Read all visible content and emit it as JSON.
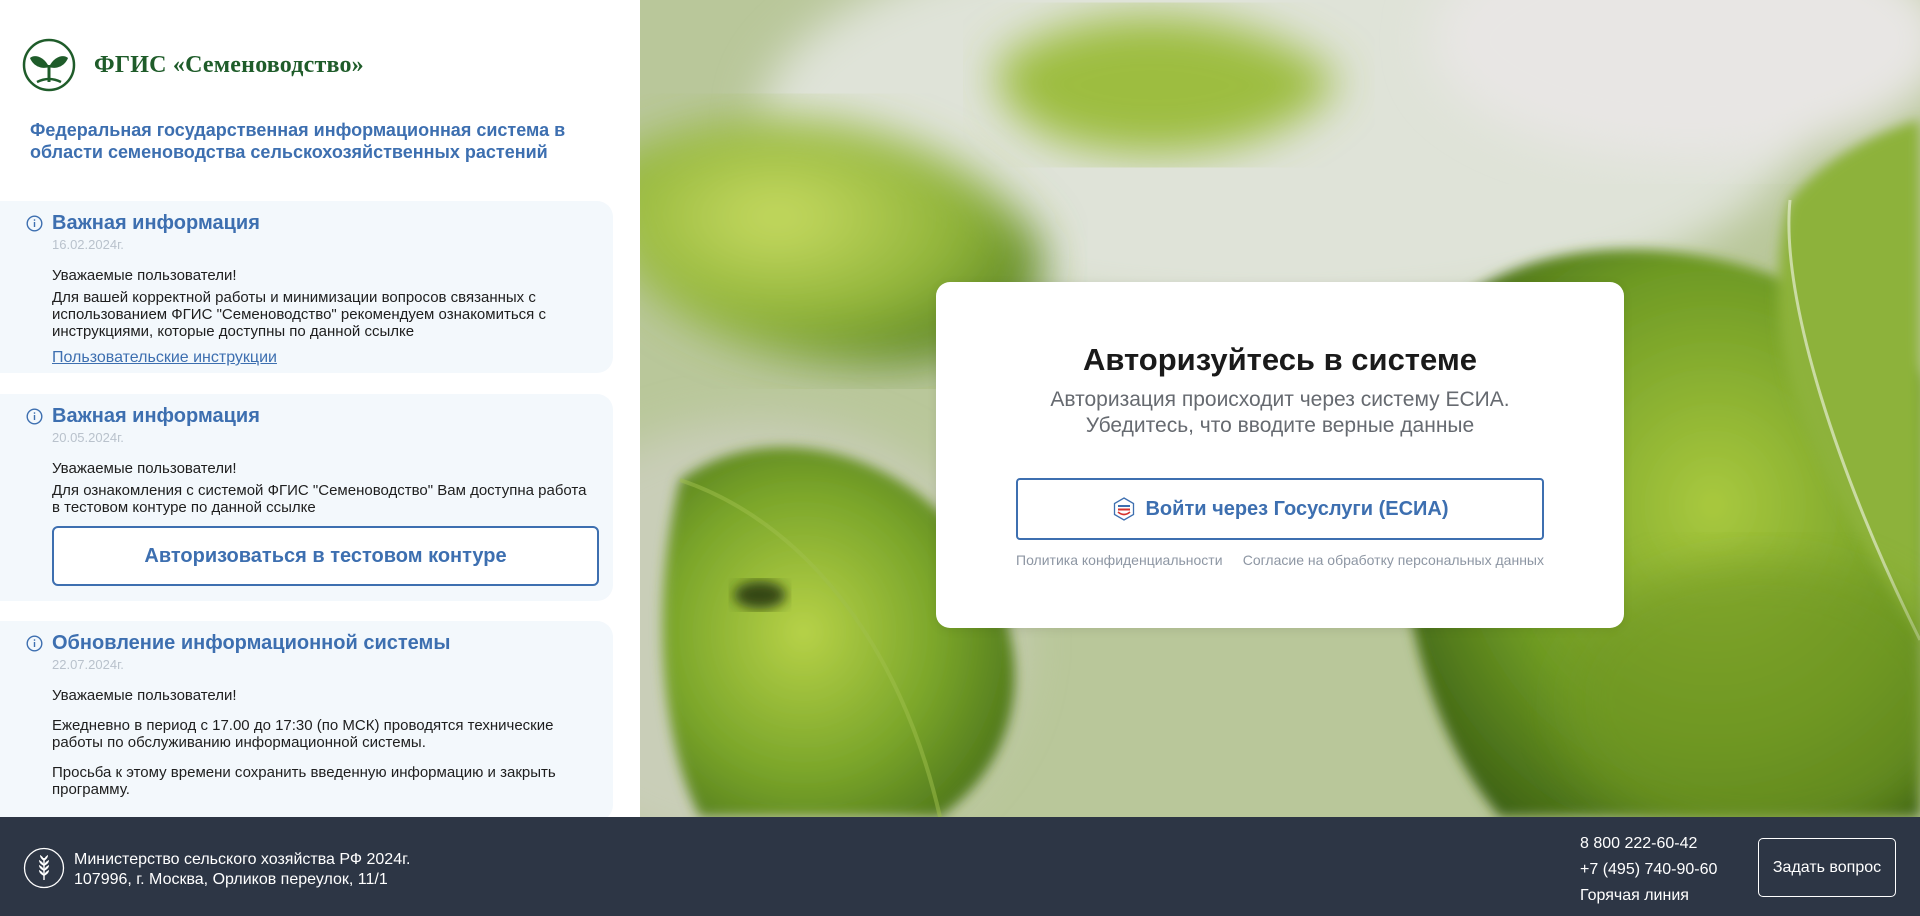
{
  "brand": {
    "name": "ФГИС «Семеноводство»",
    "subtitle": "Федеральная государственная информационная система в области семеноводства сельскохозяйственных растений",
    "color": "#1f5c2a"
  },
  "news": [
    {
      "title": "Важная информация",
      "date": "16.02.2024г.",
      "paragraphs": [
        "Уважаемые пользователи!",
        "Для вашей корректной работы и минимизации вопросов связанных с использованием ФГИС \"Семеноводство\" рекомендуем ознакомиться с инструкциями, которые доступны по данной ссылке"
      ],
      "link_label": "Пользовательские инструкции"
    },
    {
      "title": "Важная информация",
      "date": "20.05.2024г.",
      "paragraphs": [
        "Уважаемые пользователи!",
        "Для ознакомления с системой ФГИС \"Семеноводство\" Вам доступна работа в тестовом контуре по данной ссылке"
      ],
      "button_label": "Авторизоваться в тестовом контуре"
    },
    {
      "title": "Обновление информационной системы",
      "date": "22.07.2024г.",
      "paragraphs": [
        "Уважаемые пользователи!",
        "Ежедневно в период с 17.00 до 17:30 (по МСК) проводятся технические работы по обслуживанию информационной системы.",
        "Просьба к этому времени сохранить введенную информацию и закрыть программу."
      ]
    }
  ],
  "auth": {
    "title": "Авторизуйтесь в системе",
    "subtitle_line1": "Авторизация происходит через систему ЕСИА.",
    "subtitle_line2": "Убедитесь, что вводите верные данные",
    "esia_button": "Войти через Госуслуги (ЕСИА)",
    "privacy_link": "Политика конфиденциальности",
    "consent_link": "Согласие на обработку персональных данных"
  },
  "footer": {
    "org_line1": "Министерство сельского хозяйства РФ 2024г.",
    "org_line2": "107996, г. Москва, Орликов переулок, 11/1",
    "phone1": "8 800 222-60-42",
    "phone2": "+7 (495) 740-90-60",
    "hotline": "Горячая линия",
    "ask_button": "Задать вопрос"
  },
  "colors": {
    "accent": "#3d6fb0",
    "footer_bg": "#2d3645",
    "card_bg": "#f3f8fc"
  },
  "icons": [
    "sprout-logo-icon",
    "info-icon",
    "gosuslugi-icon",
    "wheat-emblem-icon"
  ]
}
